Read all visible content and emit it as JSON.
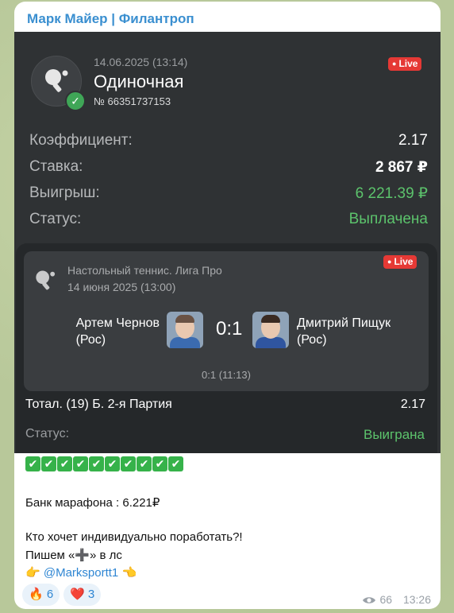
{
  "channel": {
    "name": "Марк Майер | Филантроп"
  },
  "bet": {
    "date": "14.06.2025 (13:14)",
    "type": "Одиночная",
    "number": "№ 66351737153",
    "live_badge": "Live",
    "rows": [
      {
        "label": "Коэффициент:",
        "value": "2.17"
      },
      {
        "label": "Ставка:",
        "value": "2 867 ₽"
      },
      {
        "label": "Выигрыш:",
        "value": "6 221.39 ₽"
      },
      {
        "label": "Статус:",
        "value": "Выплачена"
      }
    ]
  },
  "event": {
    "league": "Настольный теннис. Лига Про",
    "date": "14 июня 2025 (13:00)",
    "live_badge": "Live",
    "team1": {
      "name": "Артем Чернов",
      "country": "(Рос)"
    },
    "team2": {
      "name": "Дмитрий Пищук",
      "country": "(Рос)"
    },
    "score": "0:1",
    "subscore": "0:1 (11:13)",
    "market": "Тотал. (19) Б. 2-я Партия",
    "odd": "2.17",
    "status_label": "Статус:",
    "status_value": "Выиграна"
  },
  "post": {
    "checks": [
      "✔",
      "✔",
      "✔",
      "✔",
      "✔",
      "✔",
      "✔",
      "✔",
      "✔",
      "✔"
    ],
    "bank_line": "Банк марафона : 6.221₽",
    "line1": "Кто хочет индивидуально поработать?!",
    "line2": "Пишем «➕» в лс",
    "point_left": "👉",
    "mention": "@Marksportt1",
    "point_right": "👈"
  },
  "reactions": [
    {
      "emoji": "🔥",
      "count": "6"
    },
    {
      "emoji": "❤️",
      "count": "3"
    }
  ],
  "meta": {
    "views": "66",
    "time": "13:26"
  },
  "colors": {
    "accent": "#3a8fd0",
    "live": "#e53935",
    "win": "#5cc36c",
    "card": "#2f3234"
  }
}
